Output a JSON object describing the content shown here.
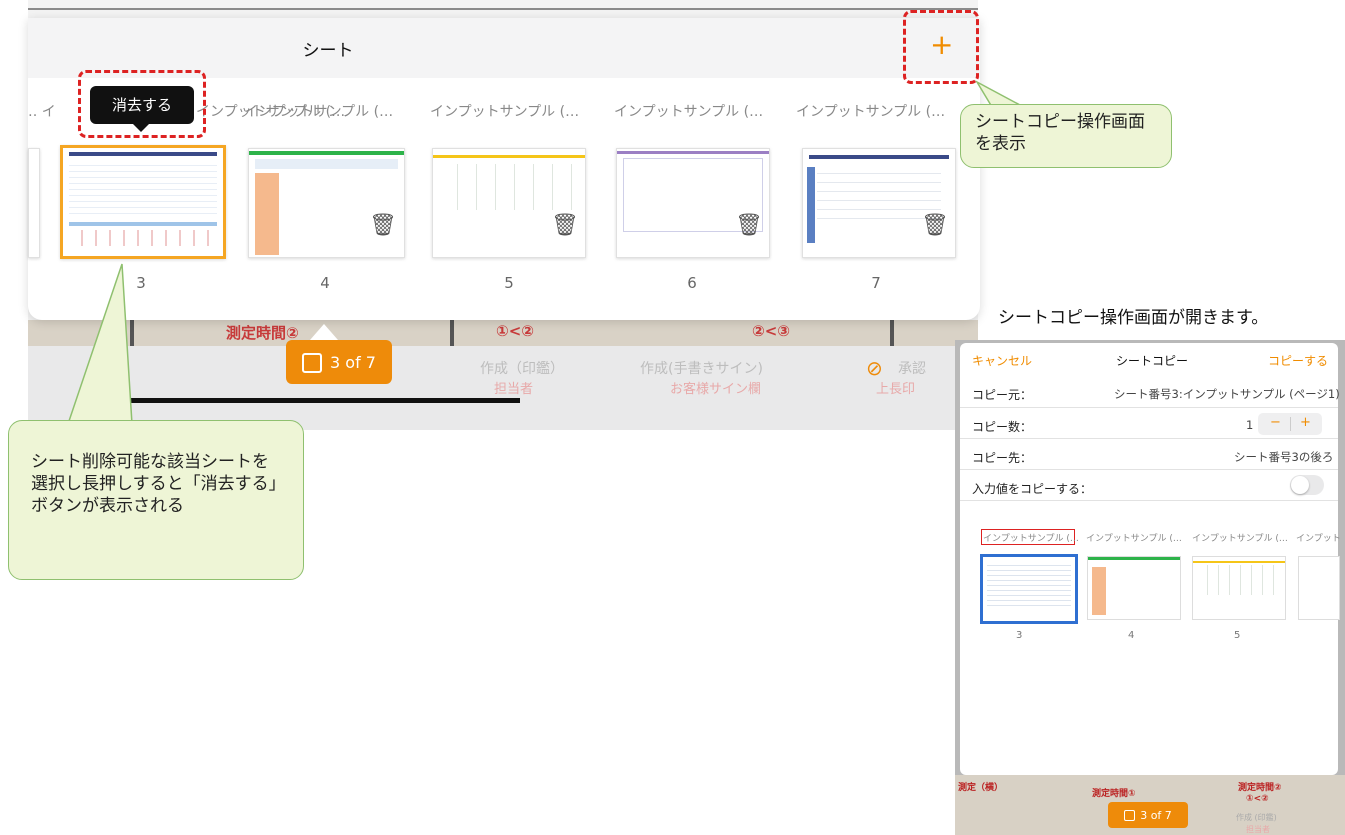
{
  "panel": {
    "title": "シート",
    "add_label": "+"
  },
  "tooltip": {
    "label": "消去する"
  },
  "sheets": [
    {
      "label": "‥ イ",
      "num": ""
    },
    {
      "label": "インプットサンプル (…",
      "num": "3"
    },
    {
      "label": "インプットサンプル (…",
      "num": "4"
    },
    {
      "label": "インプットサンプル (…",
      "num": "5"
    },
    {
      "label": "インプットサンプル (…",
      "num": "6"
    },
    {
      "label": "インプットサンプル (…",
      "num": "7"
    }
  ],
  "counter": {
    "label": "3 of 7"
  },
  "background": {
    "cell_a": "測定時間②",
    "cell_b": "①<②",
    "cell_c": "②<③",
    "col1_title": "作成（印鑑）",
    "col1_sub": "担当者",
    "col2_title": "作成(手書きサイン)",
    "col2_sub": "お客様サイン欄",
    "col3_title": "承認",
    "col3_sub": "上長印"
  },
  "callouts": {
    "copy_hint": "シートコピー操作画面を表示",
    "delete_hint": "シート削除可能な該当シートを選択し長押しすると「消去する」ボタンが表示される",
    "opens_note": "シートコピー操作画面が開きます。"
  },
  "copy_screen": {
    "cancel": "キャンセル",
    "title": "シートコピー",
    "copy": "コピーする",
    "rows": [
      {
        "label": "コピー元：",
        "value": "シート番号3:インプットサンプル (ページ1)"
      },
      {
        "label": "コピー数：",
        "value": "1"
      },
      {
        "label": "コピー先：",
        "value": "シート番号3の後ろ"
      },
      {
        "label": "入力値をコピーする：",
        "value": ""
      }
    ],
    "stepper_minus": "−",
    "stepper_plus": "+",
    "sheet_labels": [
      "インプットサンプル (…",
      "インプットサンプル (…",
      "インプットサンプル (…",
      "インプット"
    ],
    "sheet_nums": [
      "3",
      "4",
      "5"
    ],
    "bottom_a": "測定（横）",
    "bottom_b": "測定時間①",
    "bottom_c": "測定時間②",
    "bottom_d": "①<②",
    "counter": "3 of 7",
    "foot_a": "作成 (印鑑)",
    "foot_b": "担当者"
  },
  "colors": {
    "accent": "#ee8b0a",
    "callout_fill": "#eef5d6",
    "callout_border": "#8fc06f",
    "dash": "#dd2222",
    "selection": "#f5a623"
  }
}
